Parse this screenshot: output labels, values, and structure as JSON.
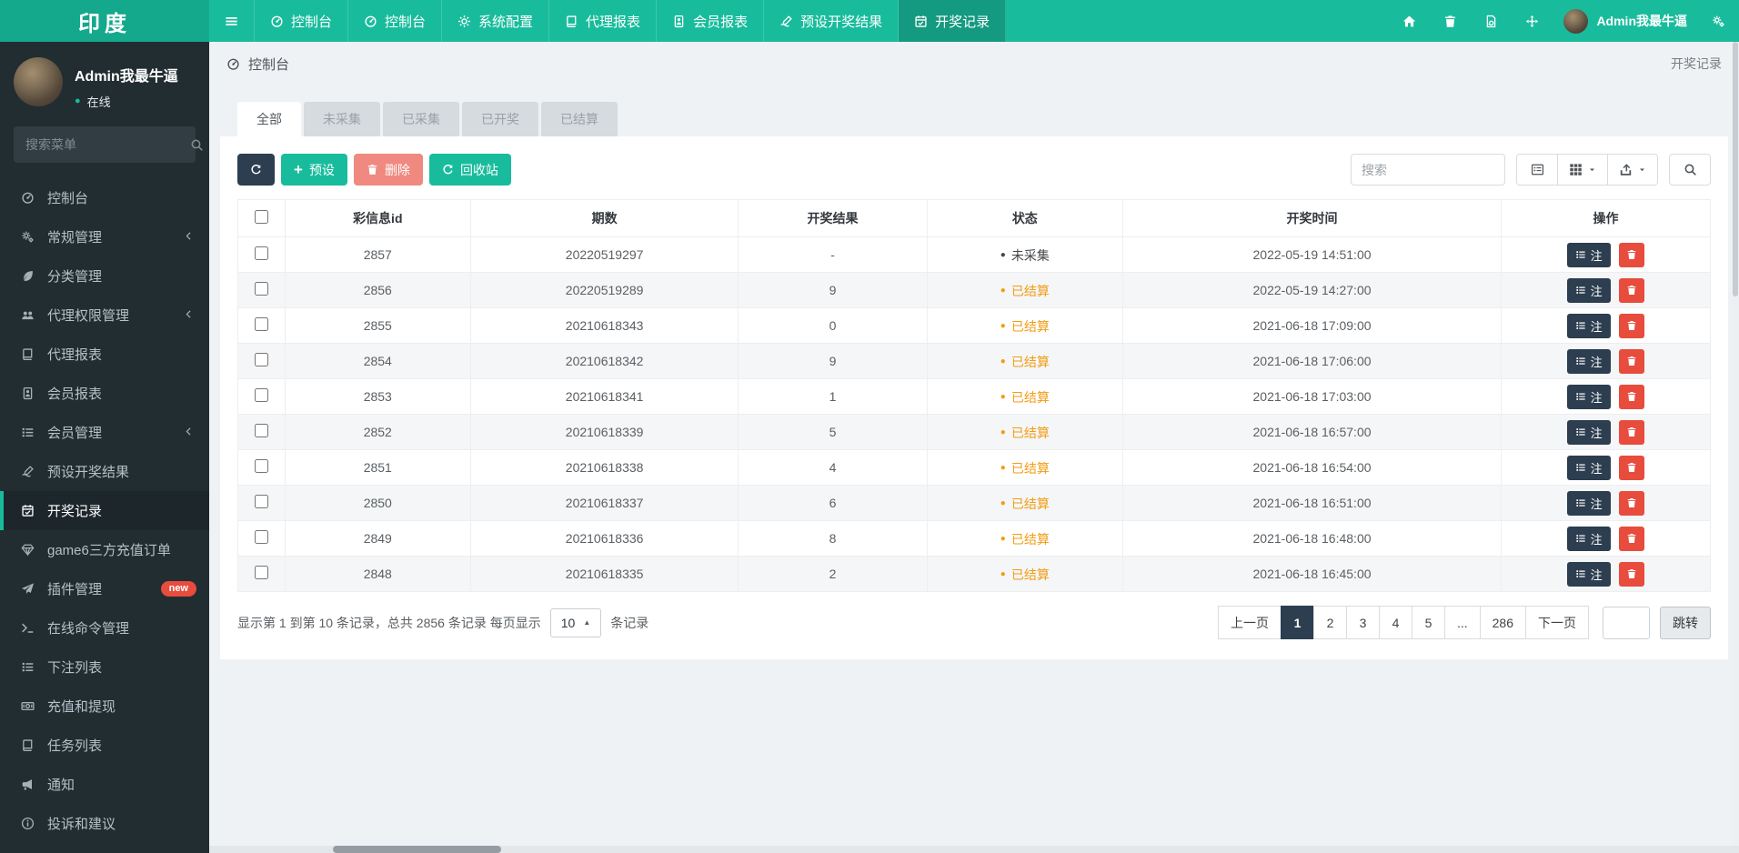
{
  "topbar": {
    "logo": "印度",
    "nav": [
      {
        "icon": "gauge",
        "label": "控制台",
        "active": false
      },
      {
        "icon": "gauge",
        "label": "控制台",
        "active": false
      },
      {
        "icon": "gear",
        "label": "系统配置",
        "active": false
      },
      {
        "icon": "book",
        "label": "代理报表",
        "active": false
      },
      {
        "icon": "idcard",
        "label": "会员报表",
        "active": false
      },
      {
        "icon": "preset",
        "label": "预设开奖结果",
        "active": false
      },
      {
        "icon": "calendar",
        "label": "开奖记录",
        "active": true
      }
    ],
    "right_icons": [
      "home",
      "trash",
      "docr",
      "expand"
    ],
    "user": {
      "name": "Admin我最牛逼"
    }
  },
  "sidebar": {
    "user": {
      "name": "Admin我最牛逼",
      "status": "在线"
    },
    "search_placeholder": "搜索菜单",
    "items": [
      {
        "icon": "gauge",
        "label": "控制台"
      },
      {
        "icon": "gears",
        "label": "常规管理",
        "chevron": true
      },
      {
        "icon": "leaf",
        "label": "分类管理"
      },
      {
        "icon": "users",
        "label": "代理权限管理",
        "chevron": true
      },
      {
        "icon": "book",
        "label": "代理报表"
      },
      {
        "icon": "idcard",
        "label": "会员报表"
      },
      {
        "icon": "list",
        "label": "会员管理",
        "chevron": true
      },
      {
        "icon": "preset",
        "label": "预设开奖结果"
      },
      {
        "icon": "calendar",
        "label": "开奖记录",
        "active": true
      },
      {
        "icon": "gem",
        "label": "game6三方充值订单"
      },
      {
        "icon": "plane",
        "label": "插件管理",
        "badge": "new"
      },
      {
        "icon": "terminal",
        "label": "在线命令管理"
      },
      {
        "icon": "list",
        "label": "下注列表"
      },
      {
        "icon": "money",
        "label": "充值和提现"
      },
      {
        "icon": "book",
        "label": "任务列表"
      },
      {
        "icon": "bullhorn",
        "label": "通知"
      },
      {
        "icon": "info",
        "label": "投诉和建议"
      }
    ]
  },
  "breadcrumb": {
    "left": "控制台",
    "right": "开奖记录"
  },
  "tabs": [
    {
      "label": "全部",
      "active": true
    },
    {
      "label": "未采集",
      "active": false
    },
    {
      "label": "已采集",
      "active": false
    },
    {
      "label": "已开奖",
      "active": false
    },
    {
      "label": "已结算",
      "active": false
    }
  ],
  "toolbar": {
    "preset_label": "预设",
    "delete_label": "删除",
    "recycle_label": "回收站",
    "search_placeholder": "搜索"
  },
  "table": {
    "columns": [
      "彩信息id",
      "期数",
      "开奖结果",
      "状态",
      "开奖时间",
      "操作"
    ],
    "note_label": "注",
    "rows": [
      {
        "id": "2857",
        "issue": "20220519297",
        "result": "-",
        "status": "未采集",
        "settled": false,
        "time": "2022-05-19 14:51:00"
      },
      {
        "id": "2856",
        "issue": "20220519289",
        "result": "9",
        "status": "已结算",
        "settled": true,
        "time": "2022-05-19 14:27:00"
      },
      {
        "id": "2855",
        "issue": "20210618343",
        "result": "0",
        "status": "已结算",
        "settled": true,
        "time": "2021-06-18 17:09:00"
      },
      {
        "id": "2854",
        "issue": "20210618342",
        "result": "9",
        "status": "已结算",
        "settled": true,
        "time": "2021-06-18 17:06:00"
      },
      {
        "id": "2853",
        "issue": "20210618341",
        "result": "1",
        "status": "已结算",
        "settled": true,
        "time": "2021-06-18 17:03:00"
      },
      {
        "id": "2852",
        "issue": "20210618339",
        "result": "5",
        "status": "已结算",
        "settled": true,
        "time": "2021-06-18 16:57:00"
      },
      {
        "id": "2851",
        "issue": "20210618338",
        "result": "4",
        "status": "已结算",
        "settled": true,
        "time": "2021-06-18 16:54:00"
      },
      {
        "id": "2850",
        "issue": "20210618337",
        "result": "6",
        "status": "已结算",
        "settled": true,
        "time": "2021-06-18 16:51:00"
      },
      {
        "id": "2849",
        "issue": "20210618336",
        "result": "8",
        "status": "已结算",
        "settled": true,
        "time": "2021-06-18 16:48:00"
      },
      {
        "id": "2848",
        "issue": "20210618335",
        "result": "2",
        "status": "已结算",
        "settled": true,
        "time": "2021-06-18 16:45:00"
      }
    ]
  },
  "footer": {
    "summary_prefix": "显示第 1 到第 10 条记录，总共 2856 条记录 每页显示",
    "page_size": "10",
    "summary_suffix": "条记录",
    "pagination": [
      {
        "label": "上一页",
        "active": false
      },
      {
        "label": "1",
        "active": true
      },
      {
        "label": "2",
        "active": false
      },
      {
        "label": "3",
        "active": false
      },
      {
        "label": "4",
        "active": false
      },
      {
        "label": "5",
        "active": false
      },
      {
        "label": "...",
        "active": false
      },
      {
        "label": "286",
        "active": false
      },
      {
        "label": "下一页",
        "active": false
      }
    ],
    "jump_label": "跳转"
  },
  "colors": {
    "accent_teal": "#18bc9c",
    "dark_navy": "#2c3e50",
    "danger_red": "#e74c3c",
    "salmon": "#f0897f",
    "settled_orange": "#f39c12",
    "sidebar_bg": "#222d32"
  }
}
